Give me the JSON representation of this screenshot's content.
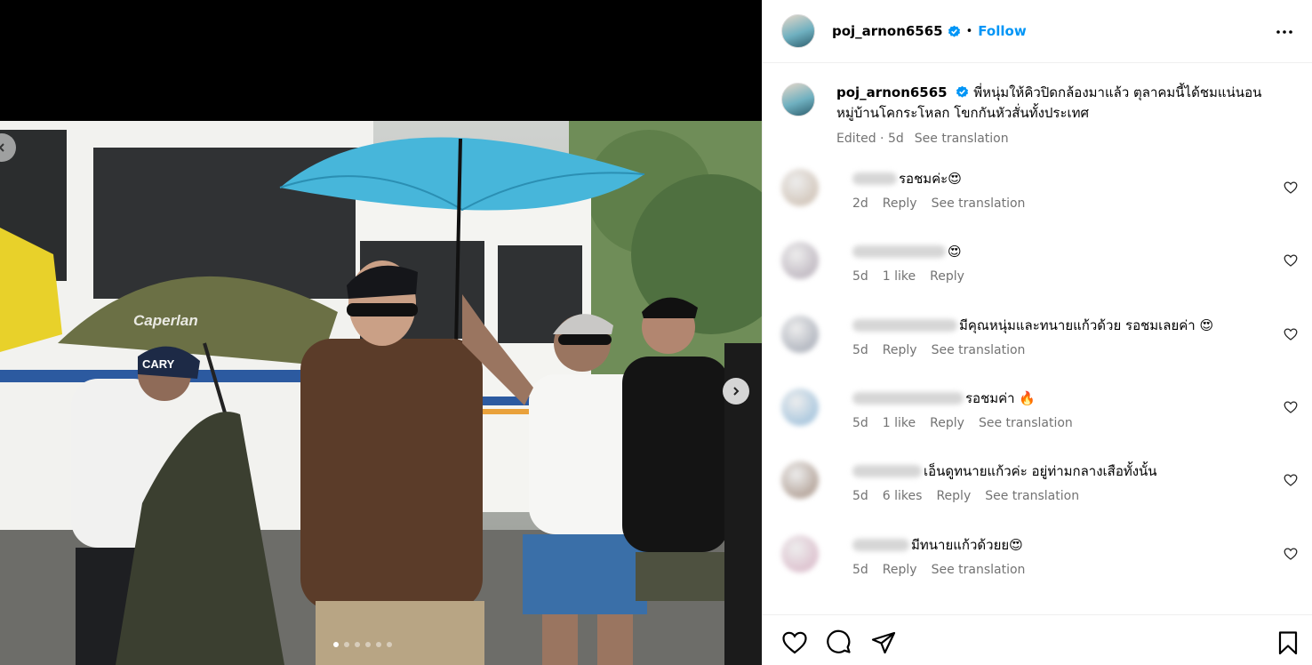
{
  "post": {
    "author": "poj_arnon6565",
    "follow_label": "Follow",
    "bullet": "•",
    "verified_icon": "verified-badge-icon",
    "caption_line1": "พี่หนุ่มให้คิวปิดกล้องมาแล้ว ตุลาคมนี้ได้ชมแน่นอน",
    "caption_line2": "หมู่บ้านโคกระโหลก โขกกันหัวสั่นทั้งประเทศ",
    "edited": "Edited · 5d",
    "see_translation": "See translation",
    "carousel": {
      "total": 6,
      "active": 1
    }
  },
  "comments": [
    {
      "text": "รอชมค่ะ😍",
      "time": "2d",
      "likes": "",
      "reply": "Reply",
      "translate": "See translation"
    },
    {
      "text": "😍",
      "time": "5d",
      "likes": "1 like",
      "reply": "Reply",
      "translate": ""
    },
    {
      "text": "มีคุณหนุ่มและทนายแก้วด้วย รอชมเลยค่า 😍",
      "time": "5d",
      "likes": "",
      "reply": "Reply",
      "translate": "See translation"
    },
    {
      "text": "รอชมค่า 🔥",
      "time": "5d",
      "likes": "1 like",
      "reply": "Reply",
      "translate": "See translation"
    },
    {
      "text": "เอ็นดูทนายแก้วค่ะ อยู่ท่ามกลางเสือทั้งนั้น",
      "time": "5d",
      "likes": "6 likes",
      "reply": "Reply",
      "translate": "See translation"
    },
    {
      "text": "มีทนายแก้วด้วยย😍",
      "time": "5d",
      "likes": "",
      "reply": "Reply",
      "translate": "See translation"
    }
  ],
  "photo_text": {
    "umbrella_brand": "Caperlan",
    "cap_text": "CARY"
  },
  "colors": {
    "accent": "#0095f6",
    "muted": "#737373",
    "border": "#efefef"
  },
  "icons": [
    "more-options-icon",
    "heart-icon",
    "comment-icon",
    "share-icon",
    "bookmark-icon",
    "chevron-right-icon",
    "chevron-left-icon"
  ]
}
